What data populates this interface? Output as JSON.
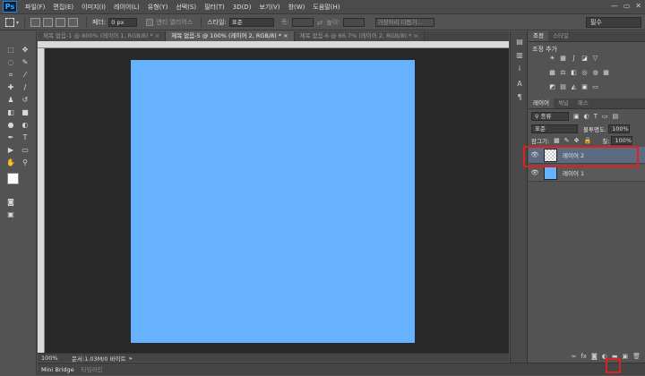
{
  "app": {
    "logo": "Ps"
  },
  "menu": [
    "파일(F)",
    "편집(E)",
    "이미지(I)",
    "레이어(L)",
    "유형(Y)",
    "선택(S)",
    "필터(T)",
    "3D(D)",
    "보기(V)",
    "창(W)",
    "도움말(H)"
  ],
  "window_controls": {
    "minimize": "—",
    "restore": "▭",
    "close": "✕"
  },
  "options": {
    "feather_label": "페더:",
    "feather_value": "0 px",
    "antialias_label": "앤티 앨리어스",
    "style_label": "스타일:",
    "style_value": "표준",
    "width_label": "폭:",
    "height_label": "높이:",
    "refine_edge": "가장자리 다듬기...",
    "workspace": "필수"
  },
  "tabs": [
    {
      "label": "제목 없음-1 @ 800% (레이어 1, RGB/8) *",
      "active": false
    },
    {
      "label": "제목 없음-5 @ 100% (레이어 2, RGB/8) *",
      "active": true
    },
    {
      "label": "제목 없음-6 @ 66.7% (레이어 2, RGB/8) *",
      "active": false
    }
  ],
  "tab_close": "×",
  "status": {
    "zoom": "100%",
    "doc_info": "문서:1.03M/0 바이트",
    "arrow": "▸"
  },
  "bottom_tabs": {
    "active": "Mini Bridge",
    "inactive": "타임라인"
  },
  "adjustments": {
    "tabs": [
      "조정",
      "스타일"
    ],
    "title": "조정 추가"
  },
  "layers": {
    "tabs": [
      "레이어",
      "채널",
      "패스"
    ],
    "filter_kind": "종류",
    "blend_mode": "표준",
    "opacity_label": "불투명도:",
    "opacity_value": "100%",
    "lock_label": "잠그기:",
    "fill_label": "칠:",
    "fill_value": "100%",
    "items": [
      {
        "name": "레이어 2",
        "selected": true
      },
      {
        "name": "레이어 1",
        "selected": false
      }
    ]
  },
  "colors": {
    "canvas": "#66b2ff",
    "highlight": "#e02020"
  }
}
